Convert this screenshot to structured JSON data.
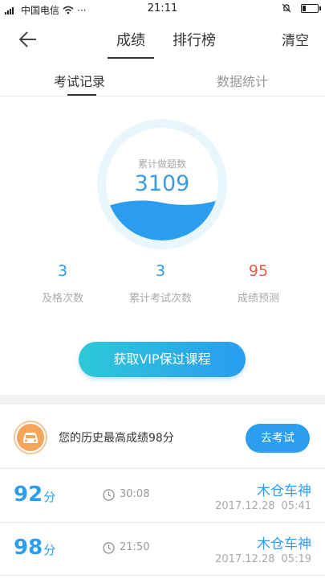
{
  "status_bar": {
    "carrier": "中国电信",
    "time": "21:11",
    "more": "···"
  },
  "nav": {
    "tabs": [
      "成绩",
      "排行榜"
    ],
    "active_tab": 0,
    "clear_label": "清空"
  },
  "subtabs": {
    "items": [
      "考试记录",
      "数据统计"
    ],
    "active": 0
  },
  "gauge": {
    "label": "累计做题数",
    "value": "3109"
  },
  "stats": [
    {
      "value": "3",
      "label": "及格次数",
      "color": "#2b9ef0"
    },
    {
      "value": "3",
      "label": "累计考试次数",
      "color": "#2b9ef0"
    },
    {
      "value": "95",
      "label": "成绩预测",
      "color": "#e25b4b"
    }
  ],
  "vip_button": "获取VIP保过课程",
  "best": {
    "text": "您的历史最高成绩98分",
    "go_label": "去考试",
    "icon": "car-icon"
  },
  "records": [
    {
      "score": "92",
      "unit": "分",
      "duration": "30:08",
      "title": "木仓车神",
      "date": "2017.12.28",
      "time": "05:41"
    },
    {
      "score": "98",
      "unit": "分",
      "duration": "21:50",
      "title": "木仓车神",
      "date": "2017.12.28",
      "time": "05:19"
    }
  ],
  "colors": {
    "accent": "#2b9ef0",
    "danger": "#e25b4b",
    "gradient_start": "#2dc9d8",
    "gradient_end": "#2a9cf0"
  }
}
